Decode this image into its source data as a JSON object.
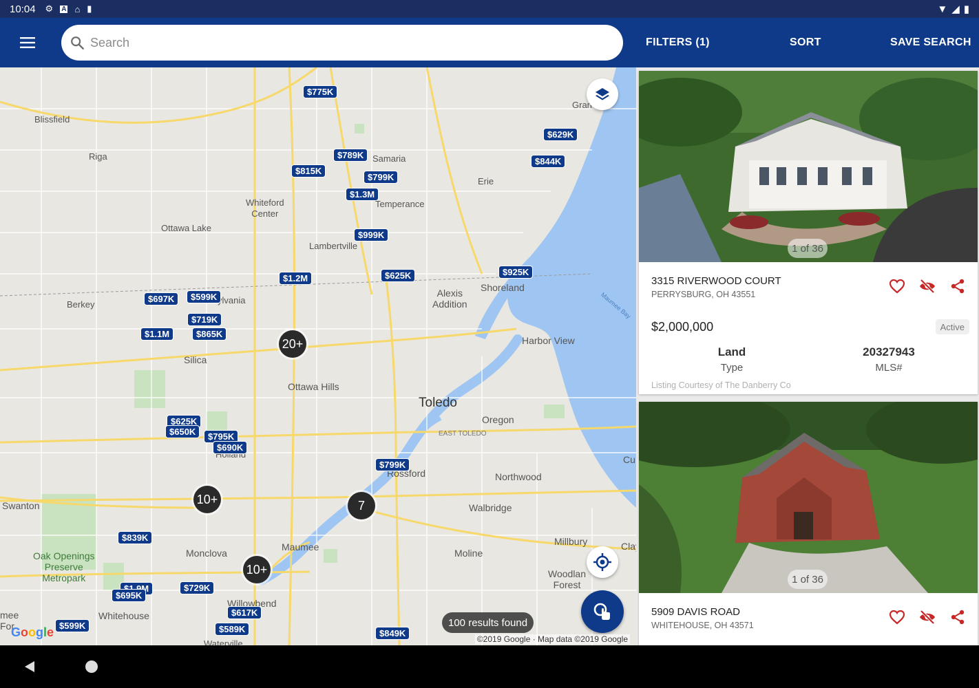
{
  "status_bar": {
    "time": "10:04"
  },
  "search": {
    "placeholder": "Search"
  },
  "actions": {
    "filters": "FILTERS (1)",
    "sort": "SORT",
    "save_search": "SAVE SEARCH"
  },
  "map": {
    "places": [
      {
        "label": "Blissfield"
      },
      {
        "label": "Riga"
      },
      {
        "label": "Ottawa Lake"
      },
      {
        "label": "Berkey"
      },
      {
        "label": "Whiteford\nCenter"
      },
      {
        "label": "Lambertville"
      },
      {
        "label": "Samaria"
      },
      {
        "label": "Temperance"
      },
      {
        "label": "Erie"
      },
      {
        "label": "Gran"
      },
      {
        "label": "Alexis\nAddition"
      },
      {
        "label": "Shoreland"
      },
      {
        "label": "Harbor View"
      },
      {
        "label": "ylvania"
      },
      {
        "label": "Silica"
      },
      {
        "label": "Ottawa Hills"
      },
      {
        "label": "Toledo"
      },
      {
        "label": "Oregon"
      },
      {
        "label": "EAST TOLEDO"
      },
      {
        "label": "Holland"
      },
      {
        "label": "Rossford"
      },
      {
        "label": "Northwood"
      },
      {
        "label": "Cu"
      },
      {
        "label": "Swanton"
      },
      {
        "label": "Walbridge"
      },
      {
        "label": "Maumee"
      },
      {
        "label": "Moline"
      },
      {
        "label": "Millbury"
      },
      {
        "label": "Monclova"
      },
      {
        "label": "Oak Openings\nPreserve\nMetropark"
      },
      {
        "label": "Woodlan\nForest"
      },
      {
        "label": "Whitehouse"
      },
      {
        "label": "Willowbend"
      },
      {
        "label": "Clay"
      },
      {
        "label": "mee\nFor"
      },
      {
        "label": "Waterville"
      },
      {
        "label": "Maumee Bay"
      }
    ],
    "price_pins": [
      "$775K",
      "$629K",
      "$789K",
      "$815K",
      "$799K",
      "$844K",
      "$1.3M",
      "$999K",
      "$625K",
      "$925K",
      "$1.2M",
      "$697K",
      "$599K",
      "$719K",
      "$1.1M",
      "$865K",
      "$625K",
      "$650K",
      "$795K",
      "$690K",
      "$799K",
      "$839K",
      "$1.9M",
      "$695K",
      "$729K",
      "$617K",
      "$589K",
      "$599K",
      "$849K"
    ],
    "clusters": [
      "20+",
      "10+",
      "7",
      "10+"
    ],
    "results_text": "100 results found",
    "attribution": "©2019 Google · Map data ©2019 Google",
    "logo": "Google"
  },
  "listings": [
    {
      "photo_counter": "1 of 36",
      "address": "3315 RIVERWOOD COURT",
      "city": "PERRYSBURG, OH 43551",
      "price": "$2,000,000",
      "status": "Active",
      "type_value": "Land",
      "type_label": "Type",
      "mls_value": "20327943",
      "mls_label": "MLS#",
      "courtesy": "Listing Courtesy of The Danberry Co"
    },
    {
      "photo_counter": "1 of 36",
      "address": "5909 DAVIS ROAD",
      "city": "WHITEHOUSE, OH 43571"
    }
  ],
  "colors": {
    "app_bar": "#0f3a8a",
    "status_bar": "#1b2e62",
    "pin": "#0f3a8a",
    "heart": "#c62828"
  }
}
